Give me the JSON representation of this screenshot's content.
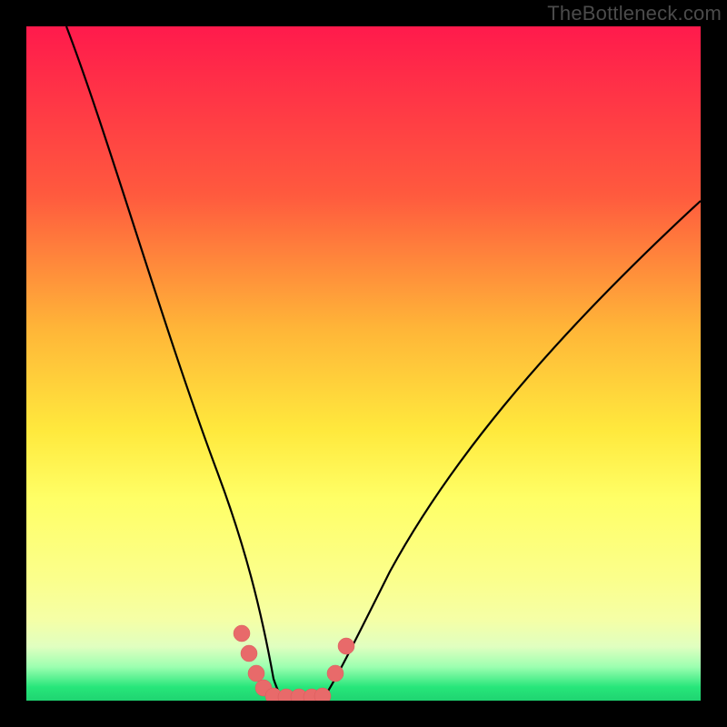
{
  "watermark": {
    "text": "TheBottleneck.com"
  },
  "chart_data": {
    "type": "line",
    "title": "",
    "xlabel": "",
    "ylabel": "",
    "xlim": [
      0,
      100
    ],
    "ylim": [
      0,
      100
    ],
    "grid": false,
    "legend": false,
    "series": [
      {
        "name": "curve-left",
        "x": [
          6,
          10,
          15,
          20,
          25,
          28,
          30,
          32,
          33,
          34,
          35,
          36
        ],
        "y": [
          100,
          82,
          62,
          45,
          30,
          21,
          16,
          10,
          7,
          4,
          2,
          0
        ]
      },
      {
        "name": "curve-right",
        "x": [
          44,
          46,
          48,
          52,
          56,
          62,
          70,
          80,
          90,
          100
        ],
        "y": [
          0,
          4,
          8,
          16,
          24,
          34,
          46,
          58,
          67,
          74
        ]
      },
      {
        "name": "flat-bottom",
        "x": [
          36,
          38,
          40,
          42,
          44
        ],
        "y": [
          0,
          0,
          0,
          0,
          0
        ]
      }
    ],
    "markers": [
      {
        "x": 32,
        "y": 10
      },
      {
        "x": 33,
        "y": 7
      },
      {
        "x": 34,
        "y": 4
      },
      {
        "x": 35,
        "y": 2
      },
      {
        "x": 36,
        "y": 0
      },
      {
        "x": 38,
        "y": 0
      },
      {
        "x": 40,
        "y": 0
      },
      {
        "x": 42,
        "y": 0
      },
      {
        "x": 44,
        "y": 0
      },
      {
        "x": 46,
        "y": 4
      },
      {
        "x": 48,
        "y": 8
      }
    ],
    "background_gradient": {
      "top": "#ff1a4c",
      "bottom": "#1fd471"
    },
    "colors": {
      "curve": "#000000",
      "marker": "#e86a6a"
    }
  }
}
